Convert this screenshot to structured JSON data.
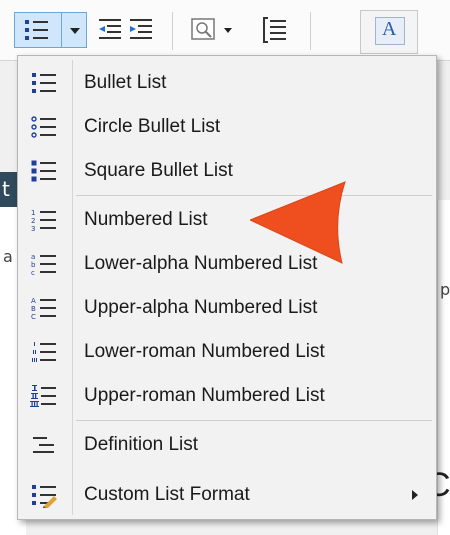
{
  "toolbar": {
    "buttons": [
      {
        "name": "list-type-button",
        "icon": "bullet-list-icon"
      },
      {
        "name": "list-type-dropdown",
        "icon": "chevron-down-icon"
      },
      {
        "name": "decrease-indent-button",
        "icon": "decrease-indent-icon"
      },
      {
        "name": "increase-indent-button",
        "icon": "increase-indent-icon"
      },
      {
        "name": "image-insert-button",
        "icon": "image-icon"
      },
      {
        "name": "block-button",
        "icon": "bracket-block-icon"
      },
      {
        "name": "text-style-button",
        "icon": "font-style-icon",
        "glyph": "A"
      }
    ]
  },
  "menu": {
    "items": [
      {
        "label": "Bullet List",
        "icon": "bullet-list-icon"
      },
      {
        "label": "Circle Bullet List",
        "icon": "circle-bullet-list-icon"
      },
      {
        "label": "Square Bullet List",
        "icon": "square-bullet-list-icon"
      },
      {
        "label": "Numbered List",
        "icon": "numbered-list-icon"
      },
      {
        "label": "Lower-alpha Numbered List",
        "icon": "lower-alpha-list-icon"
      },
      {
        "label": "Upper-alpha Numbered List",
        "icon": "upper-alpha-list-icon"
      },
      {
        "label": "Lower-roman Numbered List",
        "icon": "lower-roman-list-icon"
      },
      {
        "label": "Upper-roman Numbered List",
        "icon": "upper-roman-list-icon"
      },
      {
        "label": "Definition List",
        "icon": "definition-list-icon"
      },
      {
        "label": "Custom List Format",
        "icon": "custom-list-format-icon",
        "has_submenu": true
      }
    ]
  },
  "background": {
    "dark_strip_glyph": "t",
    "left_char": "a",
    "right_char": "p",
    "big_char": "C"
  },
  "colors": {
    "icon_blue": "#1f3f9a",
    "highlight_border": "#6aa7de",
    "highlight_fill": "#cfe6fb",
    "callout_orange": "#ef4f1e"
  }
}
